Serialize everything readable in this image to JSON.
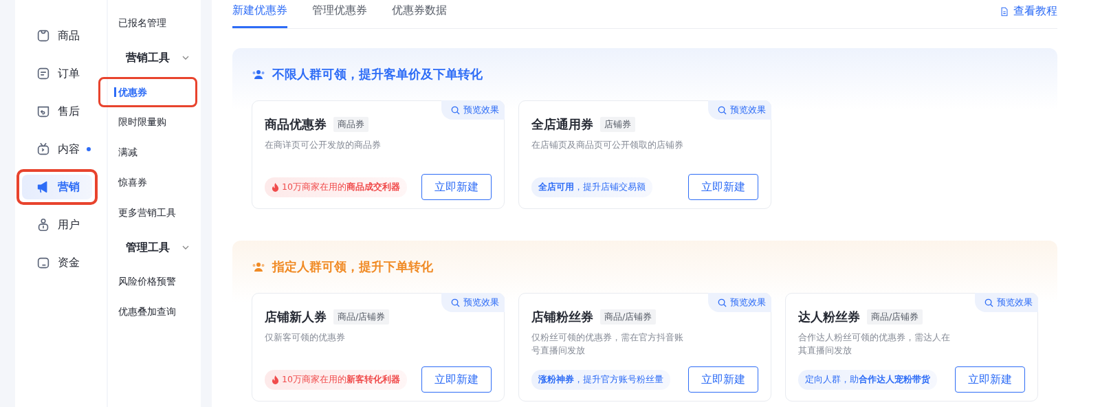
{
  "nav": {
    "items": [
      {
        "label": "商品",
        "selected": false,
        "dot": false,
        "annotated": false
      },
      {
        "label": "订单",
        "selected": false,
        "dot": false,
        "annotated": false
      },
      {
        "label": "售后",
        "selected": false,
        "dot": false,
        "annotated": false
      },
      {
        "label": "内容",
        "selected": false,
        "dot": true,
        "annotated": false
      },
      {
        "label": "营销",
        "selected": true,
        "dot": false,
        "annotated": true
      },
      {
        "label": "用户",
        "selected": false,
        "dot": false,
        "annotated": false
      },
      {
        "label": "资金",
        "selected": false,
        "dot": false,
        "annotated": false
      }
    ]
  },
  "submenu": {
    "items": [
      {
        "kind": "item",
        "label": "已报名管理",
        "selected": false,
        "annotated": false
      },
      {
        "kind": "group",
        "label": "营销工具",
        "expanded": true
      },
      {
        "kind": "item",
        "label": "优惠券",
        "selected": true,
        "annotated": true
      },
      {
        "kind": "item",
        "label": "限时限量购",
        "selected": false,
        "annotated": false
      },
      {
        "kind": "item",
        "label": "满减",
        "selected": false,
        "annotated": false
      },
      {
        "kind": "item",
        "label": "惊喜券",
        "selected": false,
        "annotated": false
      },
      {
        "kind": "item",
        "label": "更多营销工具",
        "selected": false,
        "annotated": false
      },
      {
        "kind": "group",
        "label": "管理工具",
        "expanded": true
      },
      {
        "kind": "item",
        "label": "风险价格预警",
        "selected": false,
        "annotated": false
      },
      {
        "kind": "item",
        "label": "优惠叠加查询",
        "selected": false,
        "annotated": false
      }
    ]
  },
  "tabs": [
    {
      "label": "新建优惠券",
      "selected": true
    },
    {
      "label": "管理优惠券",
      "selected": false
    },
    {
      "label": "优惠券数据",
      "selected": false
    }
  ],
  "tutorial_link": "查看教程",
  "sections": [
    {
      "kind": "blue",
      "title": "不限人群可领，提升客单价及下单转化",
      "cards": [
        {
          "title": "商品优惠券",
          "tag": "商品券",
          "description": "在商详页可公开发放的商品券",
          "pitch": {
            "kind": "hot",
            "text": "10万商家在用的**商品成交利器**"
          },
          "button": "立即新建",
          "preview": "预览效果"
        },
        {
          "title": "全店通用券",
          "tag": "店铺券",
          "description": "在店铺页及商品页可公开领取的店铺券",
          "pitch": {
            "kind": "info",
            "text": "**全店可用**，提升店铺交易额"
          },
          "button": "立即新建",
          "preview": "预览效果"
        }
      ]
    },
    {
      "kind": "orange",
      "title": "指定人群可领，提升下单转化",
      "cards": [
        {
          "title": "店铺新人券",
          "tag": "商品/店铺券",
          "description": "仅新客可领的优惠券",
          "pitch": {
            "kind": "hot",
            "text": "10万商家在用的**新客转化利器**"
          },
          "button": "立即新建",
          "preview": "预览效果"
        },
        {
          "title": "店铺粉丝券",
          "tag": "商品/店铺券",
          "description": "仅粉丝可领的优惠券，需在官方抖音账号直播间发放",
          "pitch": {
            "kind": "info",
            "text": "**涨粉神券**，提升官方账号粉丝量"
          },
          "button": "立即新建",
          "preview": "预览效果"
        },
        {
          "title": "达人粉丝券",
          "tag": "商品/店铺券",
          "description": "合作达人粉丝可领的优惠券，需达人在其直播间发放",
          "pitch": {
            "kind": "info",
            "text": "定向人群，助**合作达人宠粉带货**"
          },
          "button": "立即新建",
          "preview": "预览效果"
        }
      ]
    }
  ]
}
